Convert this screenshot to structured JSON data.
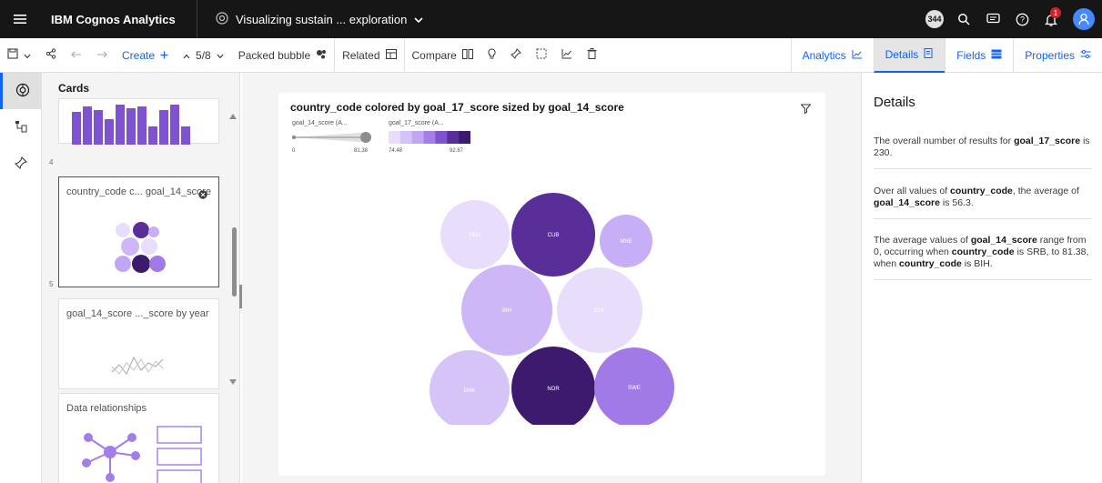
{
  "header": {
    "brand": "IBM Cognos Analytics",
    "title": "Visualizing sustain ... exploration",
    "user_badge": "344",
    "notifications_count": "1"
  },
  "toolbar": {
    "create_label": "Create",
    "page_indicator": "5/8",
    "viz_type_label": "Packed bubble",
    "related_label": "Related",
    "compare_label": "Compare",
    "tabs": {
      "analytics": "Analytics",
      "details": "Details",
      "fields": "Fields",
      "properties": "Properties"
    }
  },
  "cards_panel": {
    "title": "Cards",
    "cards": [
      {
        "number": "4",
        "label": ""
      },
      {
        "number": "5",
        "label": "country_code c... goal_14_score"
      },
      {
        "number": "",
        "label": "goal_14_score ..._score by year"
      },
      {
        "number": "",
        "label": "Data relationships"
      }
    ]
  },
  "visualization": {
    "title": "country_code colored by goal_17_score sized by goal_14_score",
    "legend_size_label": "goal_14_score (A...",
    "legend_size_min": "0",
    "legend_size_max": "81.38",
    "legend_color_label": "goal_17_score (A...",
    "legend_color_min": "74.48",
    "legend_color_max": "92.67",
    "colors": [
      "#e8ddfb",
      "#d4c3f8",
      "#c0a6f6",
      "#a47ee8",
      "#7f52cf",
      "#5a2e99",
      "#3d1a6e"
    ]
  },
  "chart_data": {
    "type": "packed-bubble",
    "title": "country_code colored by goal_17_score sized by goal_14_score",
    "bubbles": [
      {
        "label": "DEU",
        "color": "#e8ddfb"
      },
      {
        "label": "CUB",
        "color": "#5a2e99"
      },
      {
        "label": "MNE",
        "color": "#c6aff6"
      },
      {
        "label": "BIH",
        "color": "#cdb7f7"
      },
      {
        "label": "CHL",
        "color": "#e8ddfb"
      },
      {
        "label": "DNK",
        "color": "#d6c4f9"
      },
      {
        "label": "NOR",
        "color": "#3d1a6e"
      },
      {
        "label": "SWE",
        "color": "#a27ae8"
      }
    ]
  },
  "details": {
    "title": "Details",
    "items": [
      {
        "pre": "The overall number of results for ",
        "b1": "goal_17_score",
        "mid": " is 230.",
        "b2": "",
        "mid2": "",
        "b3": "",
        "post": ""
      },
      {
        "pre": "Over all values of ",
        "b1": "country_code",
        "mid": ", the average of ",
        "b2": "goal_14_score",
        "mid2": " is 56.3.",
        "b3": "",
        "post": ""
      },
      {
        "pre": "The average values of ",
        "b1": "goal_14_score",
        "mid": " range from 0, occurring when ",
        "b2": "country_code",
        "mid2": " is SRB, to 81.38, when ",
        "b3": "country_code",
        "post": " is BIH."
      }
    ]
  }
}
